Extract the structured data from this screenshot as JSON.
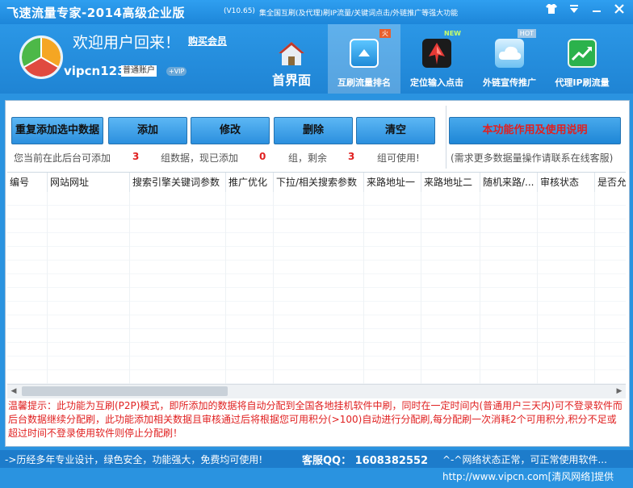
{
  "window": {
    "title": "飞速流量专家-2014高级企业版",
    "version": "(V10.65)",
    "slogan": "集全国互刷(及代理)刷IP流量/关键词点击/外链推广等强大功能",
    "controls": [
      "shirt-icon",
      "dropdown-icon",
      "minimize-icon",
      "close-icon"
    ]
  },
  "header": {
    "welcome": "欢迎用户回来！",
    "buy_link": "购买会员",
    "username": "vipcn123",
    "account_type": "普通账户",
    "vip_badge": "+VIP",
    "nav": [
      {
        "label": "首界面",
        "icon": "home-icon",
        "tag": ""
      },
      {
        "label": "互刷流量排名",
        "icon": "traffic-icon",
        "tag": "火"
      },
      {
        "label": "定位输入点击",
        "icon": "click-icon",
        "tag": "NEW"
      },
      {
        "label": "外链宣传推广",
        "icon": "cloud-icon",
        "tag": "HOT"
      },
      {
        "label": "代理IP刷流量",
        "icon": "trend-icon",
        "tag": ""
      }
    ]
  },
  "toolbar": {
    "btn_readd": "重复添加选中数据",
    "btn_add": "添加",
    "btn_edit": "修改",
    "btn_delete": "删除",
    "btn_clear": "清空",
    "btn_help": "本功能作用及使用说明",
    "info_prefix": "您当前在此后台可添加",
    "info_total": "3",
    "info_mid1": "组数据，现已添加",
    "info_added": "0",
    "info_mid2": "组，剩余",
    "info_remaining": "3",
    "info_suffix": "组可使用!",
    "info_right": "(需求更多数据量操作请联系在线客服)"
  },
  "table": {
    "columns": [
      "编号",
      "网站网址",
      "搜索引擎关键词参数",
      "推广优化",
      "下拉/相关搜索参数",
      "来路地址一",
      "来路地址二",
      "随机来路/...",
      "审核状态",
      "是否允"
    ]
  },
  "notice": "温馨提示：此功能为互刷(P2P)模式，即所添加的数据将自动分配到全国各地挂机软件中刷，同时在一定时间内(普通用户三天内)可不登录软件而后台数据继续分配刷，此功能添加相关数据且审核通过后将根据您可用积分(>100)自动进行分配刷,每分配刷一次消耗2个可用积分,积分不足或超过时间不登录使用软件则停止分配刷！",
  "status": {
    "left": "->历经多年专业设计，绿色安全，功能强大，免费均可使用!",
    "qq": "客服QQ： 1608382552",
    "network": "^-^网络状态正常，可正常使用软件..."
  },
  "watermark": "http://www.vipcn.com[清风网络]提供",
  "colors": {
    "accent": "#2a93e0",
    "warn": "#e02020"
  }
}
